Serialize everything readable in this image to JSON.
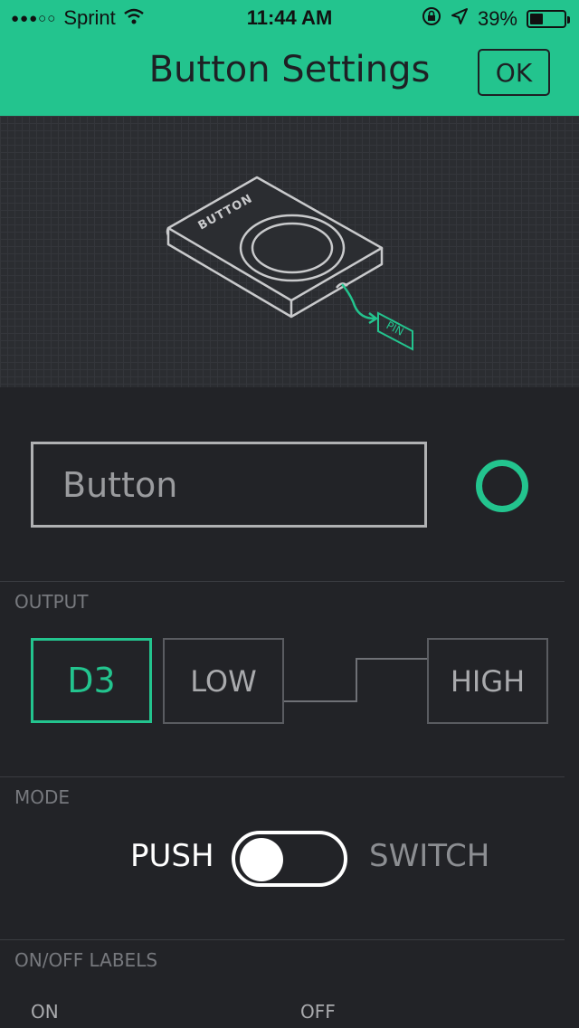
{
  "status_bar": {
    "signal": "●●●○○",
    "carrier": "Sprint",
    "time": "11:44 AM",
    "battery_percent": "39%",
    "battery_level": 0.39,
    "icons": [
      "wifi-icon",
      "orientation-lock-icon",
      "location-arrow-icon",
      "battery-icon"
    ]
  },
  "header": {
    "title": "Button Settings",
    "ok_label": "OK"
  },
  "preview": {
    "device_label": "BUTTON",
    "pin_label": "PIN"
  },
  "widget": {
    "name_placeholder": "Button",
    "color": "#23c48e"
  },
  "output": {
    "section_label": "OUTPUT",
    "pin": "D3",
    "low_value": "LOW",
    "high_value": "HIGH"
  },
  "mode": {
    "section_label": "MODE",
    "push_label": "PUSH",
    "switch_label": "SWITCH",
    "selected": "PUSH"
  },
  "labels": {
    "section_label": "ON/OFF LABELS",
    "on_label": "ON",
    "off_label": "OFF"
  },
  "colors": {
    "accent": "#23c48e",
    "background": "#222327",
    "text_muted": "#77797e"
  }
}
